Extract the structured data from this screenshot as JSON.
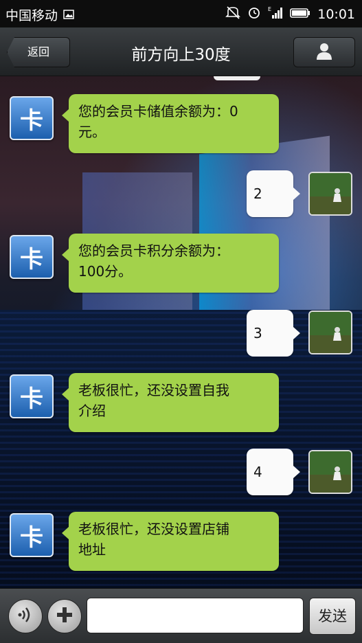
{
  "status_bar": {
    "carrier": "中国移动",
    "time": "10:01",
    "icons": [
      "image-icon",
      "mute-icon",
      "alarm-icon",
      "signal-icon",
      "battery-icon"
    ]
  },
  "header": {
    "back_label": "返回",
    "title": "前方向上30度",
    "profile_icon": "person-icon"
  },
  "messages": [
    {
      "from": "other",
      "avatar_text": "卡",
      "text_line1": "您的会员卡储值余额为：0",
      "text_line2": "元。"
    },
    {
      "from": "me",
      "text": "2"
    },
    {
      "from": "other",
      "avatar_text": "卡",
      "text_line1": "您的会员卡积分余额为：",
      "text_line2": "100分。"
    },
    {
      "from": "me",
      "text": "3"
    },
    {
      "from": "other",
      "avatar_text": "卡",
      "text_line1": "老板很忙，还没设置自我",
      "text_line2": "介绍"
    },
    {
      "from": "me",
      "text": "4"
    },
    {
      "from": "other",
      "avatar_text": "卡",
      "text_line1": "老板很忙，还没设置店铺",
      "text_line2": "地址"
    }
  ],
  "input_bar": {
    "voice_icon": "voice-icon",
    "plus_icon": "plus-icon",
    "input_value": "",
    "send_label": "发送"
  },
  "colors": {
    "incoming_bubble": "#a3d24b",
    "outgoing_bubble": "#fafafa",
    "header_bg": "#2a2d30"
  }
}
